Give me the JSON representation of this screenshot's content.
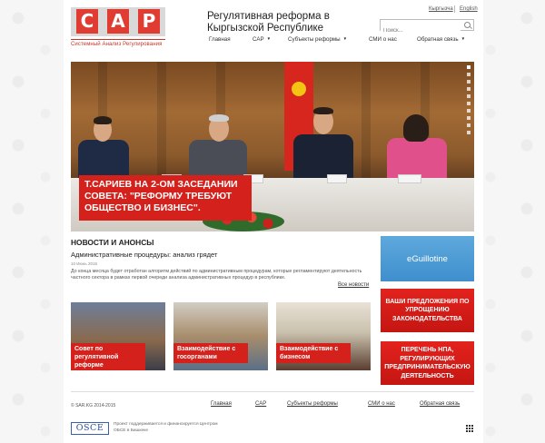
{
  "header": {
    "logo_letters": [
      "С",
      "А",
      "Р"
    ],
    "logo_subtitle": "Системный Анализ Регулирования",
    "site_title": "Регулятивная реформа в Кыргызской  Республике",
    "lang": [
      "Кыргызча",
      "English"
    ],
    "search_placeholder": "Поиск..."
  },
  "nav": [
    {
      "label": "Главная",
      "has_caret": false
    },
    {
      "label": "САР",
      "has_caret": true
    },
    {
      "label": "Субъекты реформы",
      "has_caret": true
    },
    {
      "label": "СМИ о нас",
      "has_caret": false
    },
    {
      "label": "Обратная связь",
      "has_caret": true
    }
  ],
  "hero": {
    "caption": "Т.САРИЕВ НА 2-ОМ ЗАСЕДАНИИ СОВЕТА: \"РЕФОРМУ ТРЕБУЮТ ОБЩЕСТВО И БИЗНЕС\".",
    "slides_count": 10,
    "active_slide": 1
  },
  "news": {
    "heading": "НОВОСТИ И АНОНСЫ",
    "title": "Административные процедуры: анализ грядет",
    "date": "10 Июнь 2015",
    "text": "До конца месяца будет отработан алгоритм действий по административным процедурам, которые регламентируют деятельность частного сектора в рамках первой очереди анализа административных процедур в республике.",
    "more": "Все новости"
  },
  "tiles": [
    {
      "label": "Совет по регулятивной реформе"
    },
    {
      "label": "Взаимодействие с госорганами"
    },
    {
      "label": "Взаимодействие с бизнесом"
    }
  ],
  "sidebar": {
    "blue_label": "eGuillotine",
    "red_buttons": [
      "ВАШИ ПРЕДЛОЖЕНИЯ ПО УПРОЩЕНИЮ ЗАКОНОДАТЕЛЬСТВА",
      "ПЕРЕЧЕНЬ НПА, РЕГУЛИРУЮЩИХ ПРЕДПРИНИМАТЕЛЬСКУЮ ДЕЯТЕЛЬНОСТЬ"
    ]
  },
  "footer": {
    "copyright": "© SAR.KG 2014-2015",
    "nav": [
      "Главная",
      "САР",
      "Субъекты реформы",
      "СМИ о нас",
      "Обратная связь"
    ],
    "osce_logo": "OSCE",
    "osce_text": "Проект поддерживается и финансируется Центром ОБСЕ в Бишкеке"
  },
  "colors": {
    "brand_red": "#d5211c",
    "accent_blue": "#4a9ad6",
    "osce_blue": "#2a4f9a"
  }
}
